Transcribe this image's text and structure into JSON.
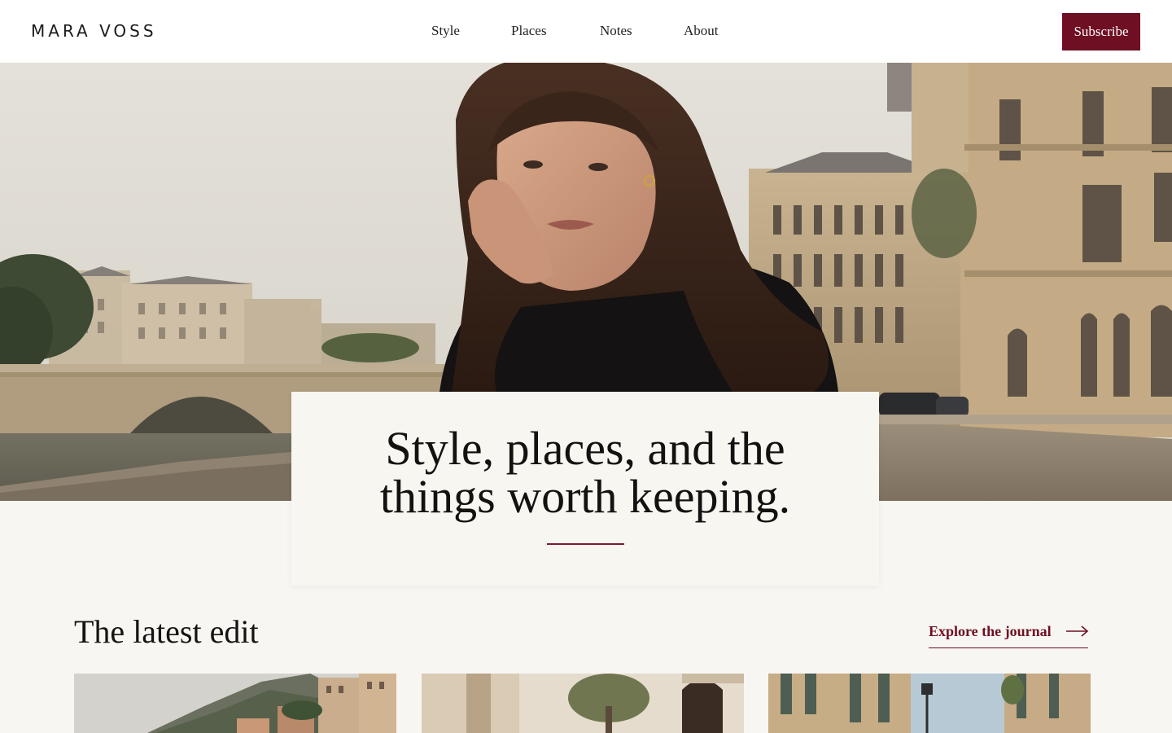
{
  "header": {
    "logo": "MARA VOSS",
    "nav": [
      {
        "label": "Style"
      },
      {
        "label": "Places"
      },
      {
        "label": "Notes"
      },
      {
        "label": "About"
      }
    ],
    "subscribe_label": "Subscribe"
  },
  "hero": {
    "title_line1": "Style, places, and the",
    "title_line2": "things worth keeping."
  },
  "latest": {
    "title": "The latest edit",
    "link_label": "Explore the journal"
  },
  "colors": {
    "accent": "#6e0f23",
    "background": "#f8f6f2"
  },
  "icons": {
    "journal_link": "arrow-right-icon"
  }
}
